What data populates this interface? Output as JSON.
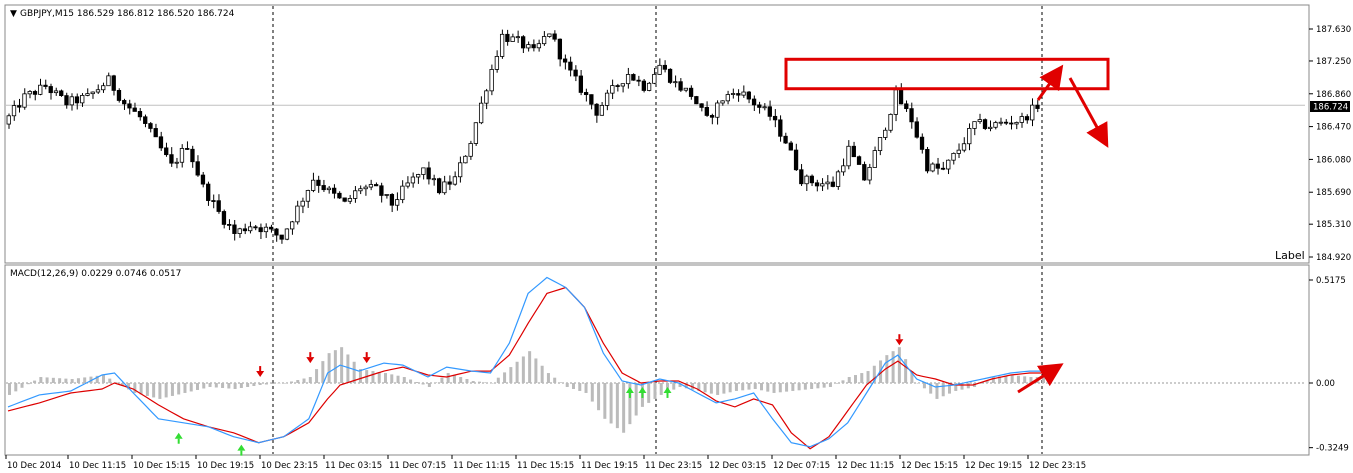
{
  "main_panel": {
    "symbol_header": "GBPJPY,M15  186.529 186.812 186.520 186.724",
    "label_text": "Label",
    "current_price_tag": "186.724"
  },
  "macd_panel": {
    "header": "MACD(12,26,9) 0.0229 0.0746 0.0517"
  },
  "colors": {
    "candle": "#000000",
    "grid_line": "#c0c0c0",
    "price_tag_bg": "#000000",
    "macd_line": "#3399ff",
    "signal_line": "#dd0000",
    "histogram": "#bbbbbb",
    "annotation": "#e00000",
    "arrow_up": "#33dd33",
    "arrow_down": "#dd0000"
  },
  "chart_data": [
    {
      "type": "candlestick",
      "title": "GBPJPY,M15",
      "price_axis_ticks": [
        "187.630",
        "187.250",
        "186.860",
        "186.470",
        "186.080",
        "185.690",
        "185.310",
        "184.920"
      ],
      "ylim": [
        184.92,
        187.83
      ],
      "current_price": 186.724,
      "annotation_zone": {
        "price_low": 186.92,
        "price_high": 187.27
      },
      "time_axis_labels": [
        "10 Dec 2014",
        "10 Dec 11:15",
        "10 Dec 15:15",
        "10 Dec 19:15",
        "10 Dec 23:15",
        "11 Dec 03:15",
        "11 Dec 07:15",
        "11 Dec 11:15",
        "11 Dec 15:15",
        "11 Dec 19:15",
        "11 Dec 23:15",
        "12 Dec 03:15",
        "12 Dec 07:15",
        "12 Dec 11:15",
        "12 Dec 15:15",
        "12 Dec 19:15",
        "12 Dec 23:15"
      ],
      "close_path": [
        [
          0,
          186.5
        ],
        [
          4,
          186.82
        ],
        [
          8,
          186.95
        ],
        [
          12,
          186.75
        ],
        [
          16,
          186.82
        ],
        [
          20,
          187.02
        ],
        [
          23,
          186.75
        ],
        [
          26,
          186.58
        ],
        [
          29,
          186.3
        ],
        [
          32,
          186.0
        ],
        [
          35,
          186.25
        ],
        [
          38,
          185.75
        ],
        [
          41,
          185.45
        ],
        [
          44,
          185.2
        ],
        [
          47,
          185.3
        ],
        [
          50,
          185.25
        ],
        [
          53,
          185.15
        ],
        [
          56,
          185.5
        ],
        [
          59,
          185.85
        ],
        [
          62,
          185.7
        ],
        [
          65,
          185.55
        ],
        [
          68,
          185.75
        ],
        [
          71,
          185.72
        ],
        [
          74,
          185.55
        ],
        [
          77,
          185.78
        ],
        [
          80,
          185.95
        ],
        [
          83,
          185.72
        ],
        [
          86,
          185.85
        ],
        [
          89,
          186.3
        ],
        [
          92,
          186.95
        ],
        [
          95,
          187.55
        ],
        [
          98,
          187.48
        ],
        [
          101,
          187.35
        ],
        [
          104,
          187.6
        ],
        [
          107,
          187.2
        ],
        [
          110,
          186.92
        ],
        [
          113,
          186.65
        ],
        [
          116,
          186.9
        ],
        [
          119,
          187.1
        ],
        [
          122,
          186.95
        ],
        [
          125,
          187.2
        ],
        [
          128,
          186.98
        ],
        [
          131,
          186.85
        ],
        [
          134,
          186.55
        ],
        [
          137,
          186.8
        ],
        [
          140,
          186.9
        ],
        [
          143,
          186.75
        ],
        [
          146,
          186.6
        ],
        [
          149,
          186.3
        ],
        [
          152,
          185.85
        ],
        [
          155,
          185.8
        ],
        [
          158,
          185.78
        ],
        [
          161,
          186.2
        ],
        [
          164,
          185.85
        ],
        [
          167,
          186.3
        ],
        [
          170,
          186.85
        ],
        [
          173,
          186.55
        ],
        [
          176,
          186.0
        ],
        [
          179,
          185.95
        ],
        [
          182,
          186.2
        ],
        [
          185,
          186.5
        ],
        [
          188,
          186.48
        ],
        [
          191,
          186.52
        ],
        [
          194,
          186.55
        ],
        [
          197,
          186.724
        ]
      ]
    },
    {
      "type": "macd",
      "title": "MACD(12,26,9)",
      "params": [
        12,
        26,
        9
      ],
      "current_values": {
        "main": 0.0229,
        "signal": 0.0746,
        "histogram": 0.0517
      },
      "axis_ticks": [
        "0.5175",
        "0.00",
        "-0.3249"
      ],
      "ylim": [
        -0.3249,
        0.5175
      ],
      "macd_path": [
        [
          0,
          -0.12
        ],
        [
          5,
          -0.06
        ],
        [
          10,
          -0.04
        ],
        [
          15,
          0.04
        ],
        [
          17,
          0.05
        ],
        [
          20,
          -0.05
        ],
        [
          24,
          -0.18
        ],
        [
          28,
          -0.2
        ],
        [
          32,
          -0.22
        ],
        [
          36,
          -0.27
        ],
        [
          40,
          -0.3
        ],
        [
          44,
          -0.27
        ],
        [
          48,
          -0.18
        ],
        [
          51,
          0.05
        ],
        [
          53,
          0.09
        ],
        [
          56,
          0.06
        ],
        [
          60,
          0.1
        ],
        [
          63,
          0.09
        ],
        [
          67,
          0.03
        ],
        [
          70,
          0.08
        ],
        [
          74,
          0.06
        ],
        [
          77,
          0.05
        ],
        [
          80,
          0.2
        ],
        [
          83,
          0.45
        ],
        [
          86,
          0.53
        ],
        [
          89,
          0.48
        ],
        [
          92,
          0.38
        ],
        [
          95,
          0.15
        ],
        [
          98,
          0.01
        ],
        [
          101,
          -0.01
        ],
        [
          104,
          0.02
        ],
        [
          107,
          0.0
        ],
        [
          110,
          -0.05
        ],
        [
          113,
          -0.1
        ],
        [
          116,
          -0.08
        ],
        [
          119,
          -0.05
        ],
        [
          122,
          -0.18
        ],
        [
          125,
          -0.3
        ],
        [
          128,
          -0.32
        ],
        [
          131,
          -0.28
        ],
        [
          134,
          -0.2
        ],
        [
          137,
          -0.05
        ],
        [
          140,
          0.1
        ],
        [
          142,
          0.14
        ],
        [
          145,
          0.02
        ],
        [
          148,
          -0.02
        ],
        [
          151,
          -0.01
        ],
        [
          154,
          0.01
        ],
        [
          157,
          0.03
        ],
        [
          160,
          0.05
        ],
        [
          163,
          0.06
        ]
      ],
      "signal_path": [
        [
          0,
          -0.14
        ],
        [
          5,
          -0.1
        ],
        [
          10,
          -0.05
        ],
        [
          15,
          -0.03
        ],
        [
          17,
          0.0
        ],
        [
          20,
          -0.03
        ],
        [
          24,
          -0.11
        ],
        [
          28,
          -0.18
        ],
        [
          32,
          -0.22
        ],
        [
          36,
          -0.25
        ],
        [
          40,
          -0.3
        ],
        [
          44,
          -0.27
        ],
        [
          48,
          -0.2
        ],
        [
          51,
          -0.08
        ],
        [
          53,
          -0.01
        ],
        [
          56,
          0.02
        ],
        [
          60,
          0.06
        ],
        [
          63,
          0.08
        ],
        [
          67,
          0.04
        ],
        [
          70,
          0.03
        ],
        [
          74,
          0.06
        ],
        [
          77,
          0.06
        ],
        [
          80,
          0.14
        ],
        [
          83,
          0.3
        ],
        [
          86,
          0.45
        ],
        [
          89,
          0.48
        ],
        [
          92,
          0.38
        ],
        [
          95,
          0.2
        ],
        [
          98,
          0.05
        ],
        [
          101,
          -0.0
        ],
        [
          104,
          0.01
        ],
        [
          107,
          0.01
        ],
        [
          110,
          -0.03
        ],
        [
          113,
          -0.09
        ],
        [
          116,
          -0.12
        ],
        [
          119,
          -0.08
        ],
        [
          122,
          -0.11
        ],
        [
          125,
          -0.25
        ],
        [
          128,
          -0.33
        ],
        [
          131,
          -0.27
        ],
        [
          134,
          -0.14
        ],
        [
          137,
          -0.01
        ],
        [
          140,
          0.07
        ],
        [
          142,
          0.11
        ],
        [
          145,
          0.04
        ],
        [
          148,
          0.02
        ],
        [
          151,
          -0.01
        ],
        [
          154,
          -0.01
        ],
        [
          157,
          0.02
        ],
        [
          160,
          0.04
        ],
        [
          163,
          0.05
        ]
      ],
      "histogram_path": [
        [
          0,
          -0.06
        ],
        [
          5,
          0.03
        ],
        [
          10,
          0.02
        ],
        [
          15,
          0.04
        ],
        [
          20,
          -0.05
        ],
        [
          24,
          -0.08
        ],
        [
          28,
          -0.05
        ],
        [
          32,
          -0.02
        ],
        [
          36,
          -0.03
        ],
        [
          40,
          -0.01
        ],
        [
          44,
          0.0
        ],
        [
          48,
          0.03
        ],
        [
          51,
          0.15
        ],
        [
          53,
          0.18
        ],
        [
          56,
          0.07
        ],
        [
          60,
          0.05
        ],
        [
          63,
          0.03
        ],
        [
          67,
          -0.02
        ],
        [
          70,
          0.05
        ],
        [
          74,
          0.01
        ],
        [
          77,
          0.0
        ],
        [
          80,
          0.08
        ],
        [
          83,
          0.16
        ],
        [
          86,
          0.05
        ],
        [
          89,
          -0.02
        ],
        [
          92,
          -0.05
        ],
        [
          95,
          -0.18
        ],
        [
          98,
          -0.25
        ],
        [
          101,
          -0.12
        ],
        [
          104,
          -0.06
        ],
        [
          107,
          -0.02
        ],
        [
          110,
          -0.04
        ],
        [
          113,
          -0.06
        ],
        [
          116,
          -0.04
        ],
        [
          119,
          -0.03
        ],
        [
          122,
          -0.05
        ],
        [
          125,
          -0.04
        ],
        [
          128,
          -0.03
        ],
        [
          131,
          -0.02
        ],
        [
          134,
          0.03
        ],
        [
          137,
          0.06
        ],
        [
          140,
          0.14
        ],
        [
          142,
          0.18
        ],
        [
          145,
          0.0
        ],
        [
          148,
          -0.08
        ],
        [
          151,
          -0.04
        ],
        [
          154,
          -0.02
        ],
        [
          157,
          0.03
        ],
        [
          160,
          0.04
        ],
        [
          163,
          0.03
        ]
      ],
      "signal_arrows": [
        {
          "bar": 40,
          "direction": "down",
          "value": 0.06
        },
        {
          "bar": 48,
          "direction": "down",
          "value": 0.13
        },
        {
          "bar": 57,
          "direction": "down",
          "value": 0.13
        },
        {
          "bar": 27,
          "direction": "up",
          "value": -0.28
        },
        {
          "bar": 37,
          "direction": "up",
          "value": -0.34
        },
        {
          "bar": 99,
          "direction": "up",
          "value": -0.05
        },
        {
          "bar": 101,
          "direction": "up",
          "value": -0.05
        },
        {
          "bar": 105,
          "direction": "up",
          "value": -0.05
        },
        {
          "bar": 142,
          "direction": "down",
          "value": 0.22
        }
      ]
    }
  ]
}
